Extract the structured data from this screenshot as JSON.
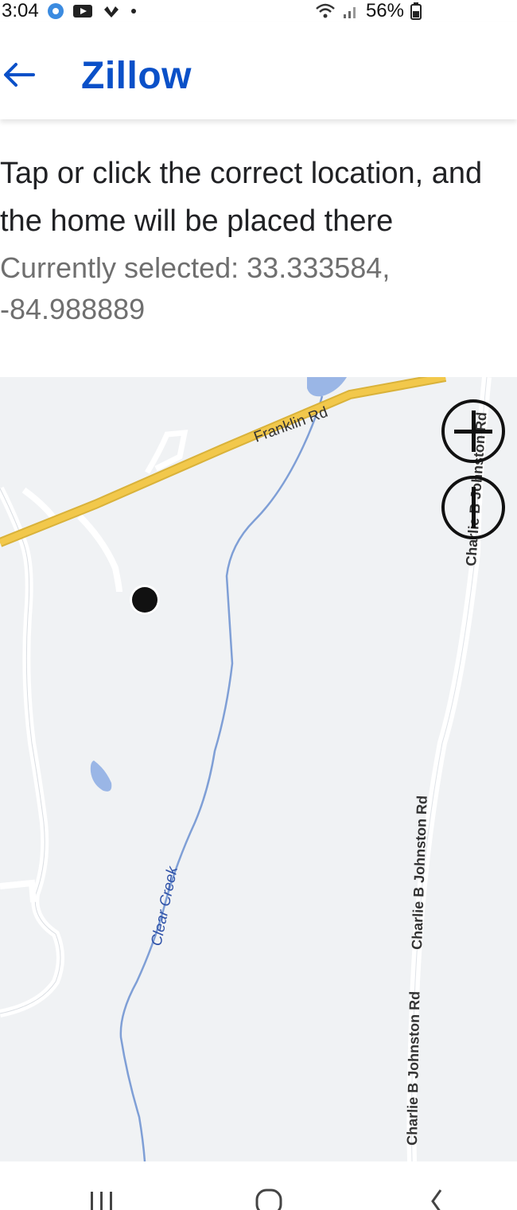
{
  "status_bar": {
    "time": "3:04",
    "battery": "56%",
    "icons": [
      "circle-app-icon",
      "youtube-icon",
      "nbc-icon",
      "dot-icon",
      "wifi-icon",
      "signal-icon",
      "battery-icon"
    ]
  },
  "app_bar": {
    "title": "Zillow",
    "back_icon": "arrow-left-icon",
    "title_color": "#0a50c8"
  },
  "content": {
    "heading_partial": "location",
    "instruction": "Tap or click the correct location, and the home will be placed there",
    "selected_label": "Currently selected:",
    "selected_coords": "33.333584, -84.988889"
  },
  "map": {
    "labels": {
      "franklin_rd": "Franklin Rd",
      "clear_creek": "Clear Creek",
      "charlie_rd_1": "Charlie B Johnston Rd",
      "charlie_rd_2": "Charlie B Johnston Rd",
      "charlie_rd_3": "Charlie B Johnston Rd"
    },
    "zoom_in_icon": "plus-icon",
    "zoom_out_icon": "minus-icon",
    "pin_icon": "location-pin-icon",
    "colors": {
      "land": "#f0f2f4",
      "main_road": "#f2c84b",
      "water": "#9ab6e6",
      "creek_line": "#7f9fd6",
      "local_road": "#ffffff"
    }
  },
  "nav_bar": {
    "recents_icon": "recents-icon",
    "home_icon": "home-icon",
    "back_icon": "back-chevron-icon"
  }
}
